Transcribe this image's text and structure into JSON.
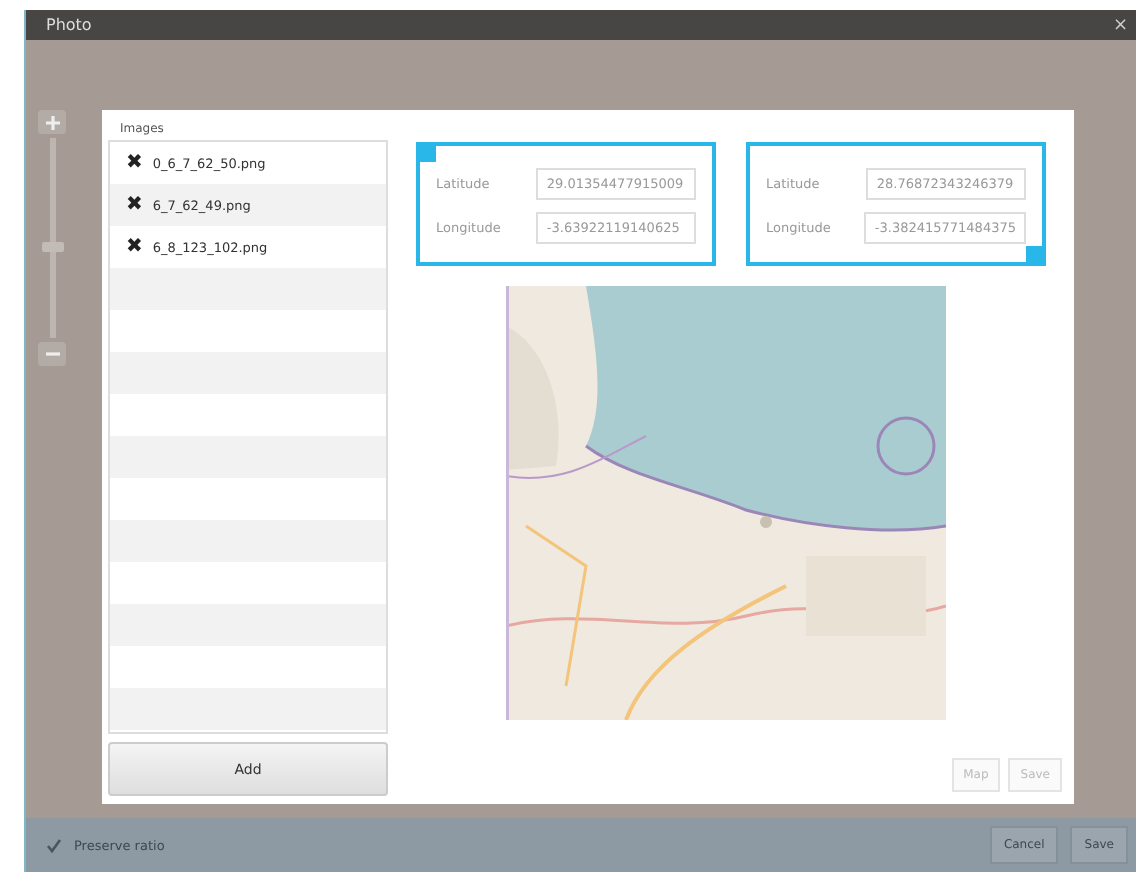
{
  "window": {
    "title": "Photo",
    "close": "×"
  },
  "zoom": {
    "level": 0.45
  },
  "images": {
    "label": "Images",
    "items": [
      {
        "name": "0_6_7_62_50.png",
        "remove": "✖"
      },
      {
        "name": "6_7_62_49.png",
        "remove": "✖"
      },
      {
        "name": "6_8_123_102.png",
        "remove": "✖"
      }
    ],
    "add_button": "Add"
  },
  "coordinates": [
    {
      "kind": "start",
      "fields": [
        {
          "label": "Latitude",
          "value": "29.01354477915009"
        },
        {
          "label": "Longitude",
          "value": "-3.63922119140625"
        }
      ]
    },
    {
      "kind": "end",
      "fields": [
        {
          "label": "Latitude",
          "value": "28.76872343246379"
        },
        {
          "label": "Longitude",
          "value": "-3.382415771484375"
        }
      ]
    }
  ],
  "map": {
    "kind": "picture"
  },
  "dialog_buttons": [
    "Map",
    "Save"
  ],
  "footer": {
    "preserve_ratio": {
      "label": "Preserve ratio",
      "checked": true
    },
    "buttons": [
      "Cancel",
      "Save"
    ]
  }
}
